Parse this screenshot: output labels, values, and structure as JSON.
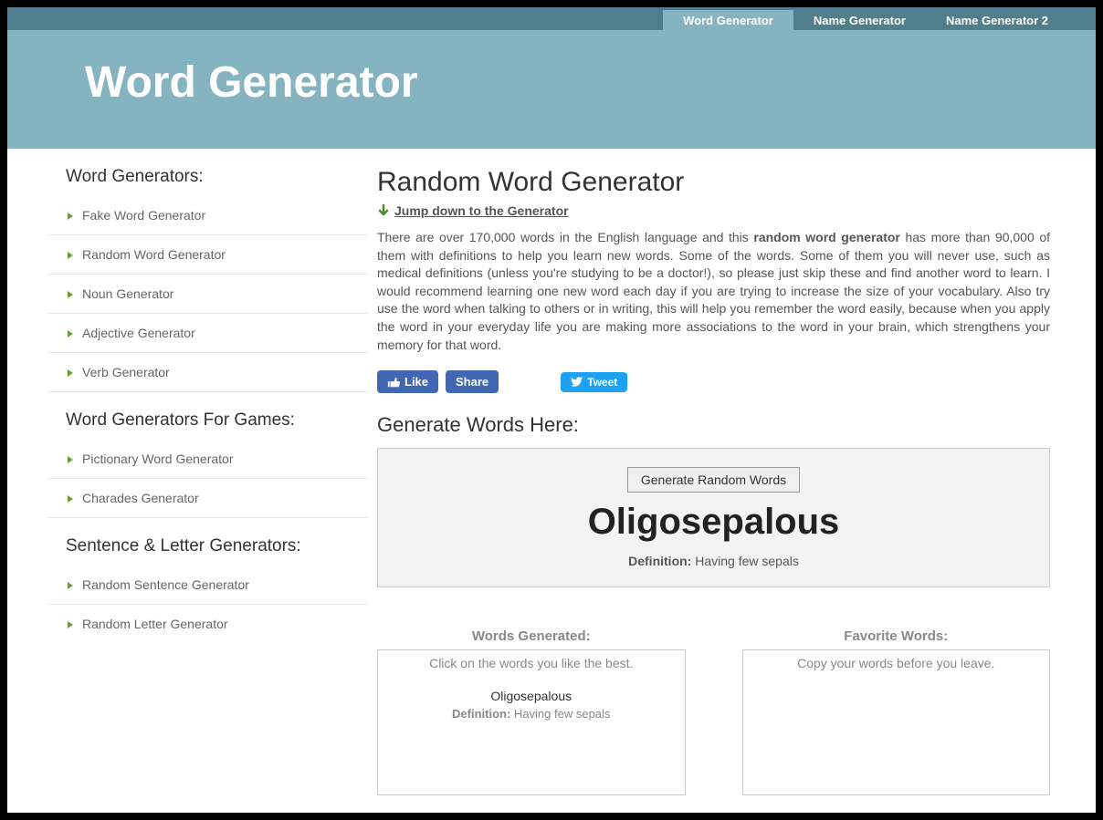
{
  "topnav": {
    "items": [
      {
        "label": "Word Generator",
        "active": true
      },
      {
        "label": "Name Generator",
        "active": false
      },
      {
        "label": "Name Generator 2",
        "active": false
      }
    ]
  },
  "header": {
    "title": "Word Generator"
  },
  "sidebar": {
    "sections": [
      {
        "title": "Word Generators:",
        "items": [
          {
            "label": "Fake Word Generator"
          },
          {
            "label": "Random Word Generator"
          },
          {
            "label": "Noun Generator"
          },
          {
            "label": "Adjective Generator"
          },
          {
            "label": "Verb Generator"
          }
        ]
      },
      {
        "title": "Word Generators For Games:",
        "items": [
          {
            "label": "Pictionary Word Generator"
          },
          {
            "label": "Charades Generator"
          }
        ]
      },
      {
        "title": "Sentence & Letter Generators:",
        "items": [
          {
            "label": "Random Sentence Generator"
          },
          {
            "label": "Random Letter Generator"
          }
        ]
      }
    ]
  },
  "main": {
    "title": "Random Word Generator",
    "jump_link": "Jump down to the Generator",
    "intro_before": "There are over 170,000 words in the English language and this ",
    "intro_bold": "random word generator",
    "intro_after": " has more than 90,000 of them with definitions to help you learn new words. Some of the words. Some of them you will never use, such as medical definitions (unless you're studying to be a doctor!), so please just skip these and find another word to learn. I would recommend learning one new word each day if you are trying to increase the size of your vocabulary. Also try use the word when talking to others or in writing, this will help you remember the word easily, because when you apply the word in your everyday life you are making more associations to the word in your brain, which strengthens your memory for that word.",
    "fb_like": "Like",
    "fb_share": "Share",
    "tweet": "Tweet",
    "gen_section_title": "Generate Words Here:",
    "generate_button": "Generate Random Words",
    "generated_word": "Oligosepalous",
    "definition_label": "Definition:",
    "definition_text": " Having few sepals",
    "words_generated_title": "Words Generated:",
    "words_generated_hint": "Click on the words you like the best.",
    "words_generated_item": "Oligosepalous",
    "words_generated_def_label": "Definition:",
    "words_generated_def_text": " Having few sepals",
    "favorite_title": "Favorite Words:",
    "favorite_hint": "Copy your words before you leave."
  }
}
